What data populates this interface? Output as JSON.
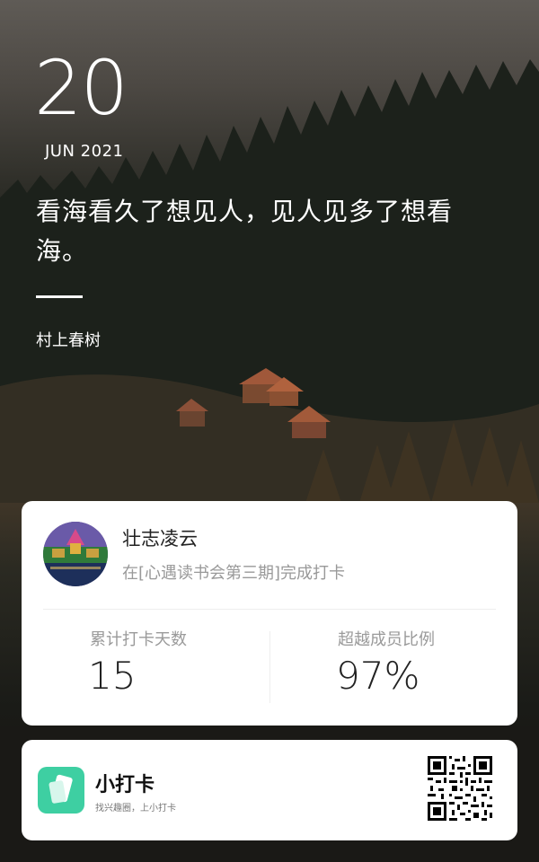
{
  "header": {
    "day": "20",
    "month_year": "JUN 2021"
  },
  "quote": {
    "text": "看海看久了想见人，见人见多了想看海。",
    "author": "村上春树"
  },
  "checkin_card": {
    "user_name": "壮志凌云",
    "subtitle": "在[心遇读书会第三期]完成打卡",
    "stats": [
      {
        "label": "累计打卡天数",
        "value": "15"
      },
      {
        "label": "超越成员比例",
        "value": "97%"
      }
    ]
  },
  "footer": {
    "app_name": "小打卡",
    "slogan": "找兴趣圈，上小打卡",
    "logo_icon": "app-logo-icon",
    "qr_icon": "qr-code-icon"
  },
  "colors": {
    "accent": "#3ecfa2",
    "text_primary": "#222222",
    "text_secondary": "#999999"
  }
}
